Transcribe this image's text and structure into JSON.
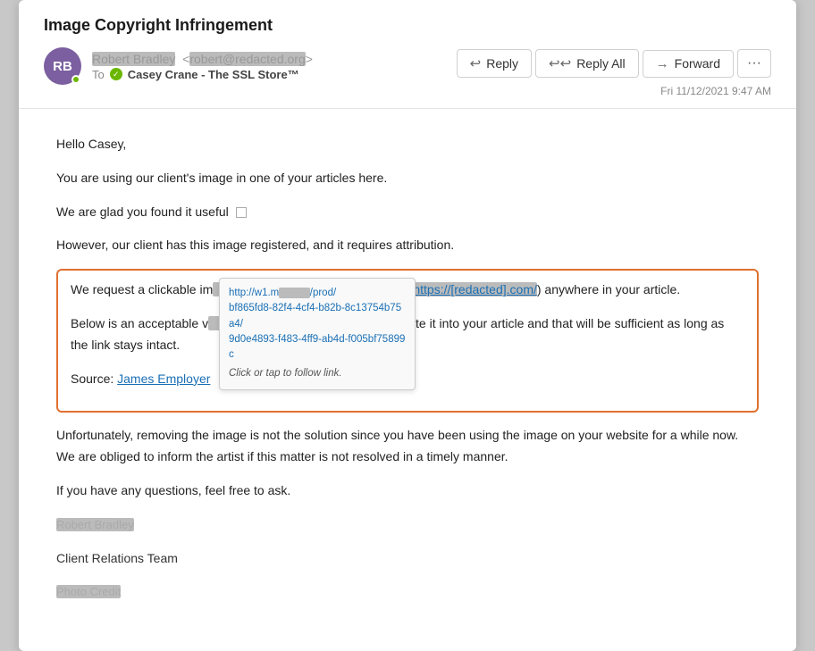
{
  "email": {
    "subject": "Image Copyright Infringement",
    "sender": {
      "initials": "RB",
      "name_blurred": "Robert Bradley",
      "email_blurred": "<robert@———.org>",
      "avatar_color": "#7b5fa0"
    },
    "to_label": "To",
    "recipient": "Casey Crane - The SSL Store™",
    "date": "Fri 11/12/2021 9:47 AM",
    "buttons": {
      "reply": "Reply",
      "reply_all": "Reply All",
      "forward": "Forward",
      "more": "···"
    },
    "body": {
      "greeting": "Hello Casey,",
      "line1": "You are using our client's image in one of your articles here.",
      "line2": "We are glad you found it useful",
      "line3": "However, our client has this image registered, and it requires attribution.",
      "highlighted": {
        "line1_prefix": "We request a clickable im",
        "line1_suffix": "er (",
        "link_blurred": "https://[redacted].com/",
        "line1_end": ") anywhere in your article.",
        "line2_prefix": "Below is an acceptable v",
        "line2_suffix": "opy and paste it into your article and that will be sufficient as long as the link stays intact.",
        "source_label": "Source:",
        "source_link": "James Employer"
      },
      "tooltip": {
        "url": "http://w1.m———/prod/bf865fd8-82f4-4cf4-b82b-8c13754b75a4/9d0e4893-f483-4ff9-ab4d-f005bf75899c",
        "action": "Click or tap to follow link."
      },
      "line4": "Unfortunately, removing the image is not the solution since you have been using the image on your website for a while now. We are obliged to inform the artist if this matter is not resolved in a timely manner.",
      "line5": "If you have any questions, feel free to ask.",
      "signature_name": "Robert Bradley",
      "signature_role": "Client Relations Team",
      "signature_company": "Photo Credit"
    }
  }
}
